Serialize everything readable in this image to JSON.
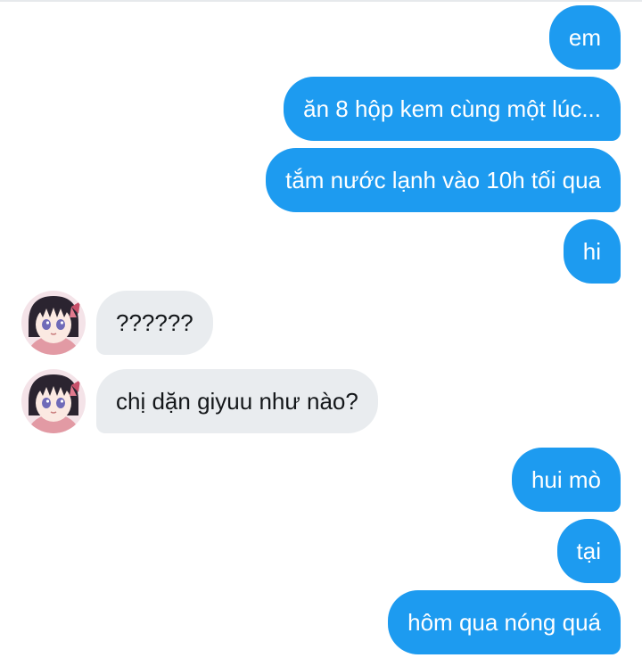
{
  "conversation": {
    "messages": [
      {
        "from": "me",
        "text": "em"
      },
      {
        "from": "me",
        "text": "ăn 8 hộp kem cùng một lúc..."
      },
      {
        "from": "me",
        "text": "tắm nước lạnh vào 10h tối qua"
      },
      {
        "from": "me",
        "text": "hi"
      },
      {
        "from": "other",
        "text": "??????",
        "avatar": "anime-girl-avatar"
      },
      {
        "from": "other",
        "text": "chị dặn giyuu như nào?",
        "avatar": "anime-girl-avatar"
      },
      {
        "from": "me",
        "text": "hui mò"
      },
      {
        "from": "me",
        "text": "tại"
      },
      {
        "from": "me",
        "text": "hôm qua nóng quá"
      }
    ]
  },
  "colors": {
    "outgoing_bubble": "#1d9bf0",
    "incoming_bubble": "#e9ecef",
    "outgoing_text": "#ffffff",
    "incoming_text": "#14171a"
  }
}
